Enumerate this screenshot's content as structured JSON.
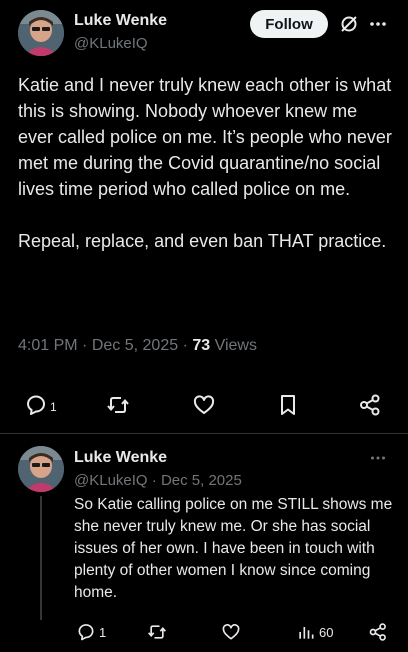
{
  "main_post": {
    "author_name": "Luke Wenke",
    "author_handle": "@KLukeIQ",
    "follow_label": "Follow",
    "text": "Katie and I never truly knew each other is what this is showing.  Nobody whoever knew me ever called police on me.  It’s people who never met me during the Covid quarantine/no social lives time period who called police on me.\n\nRepeal, replace, and even ban THAT practice.",
    "time": "4:01 PM",
    "date": "Dec 5, 2025",
    "views_count": "73",
    "views_label": "Views",
    "reply_count": "1"
  },
  "reply_post": {
    "author_name": "Luke Wenke",
    "author_handle": "@KLukeIQ",
    "date": "Dec 5, 2025",
    "text": "So Katie calling police on me STILL shows me she never truly knew me.  Or she has social issues of her own.  I have been in touch with plenty of other women I know since coming home.",
    "reply_count": "1",
    "views_count": "60"
  },
  "icons": {
    "more": "more-horizontal-icon",
    "grok": "grok-icon",
    "reply": "reply-bubble-icon",
    "retweet": "retweet-icon",
    "like": "heart-icon",
    "bookmark": "bookmark-icon",
    "share": "share-icon",
    "views": "bar-chart-icon"
  },
  "colors": {
    "background": "#000000",
    "text_primary": "#e7e9ea",
    "text_secondary": "#71767b",
    "follow_bg": "#eff3f4",
    "divider": "#2f3336"
  }
}
